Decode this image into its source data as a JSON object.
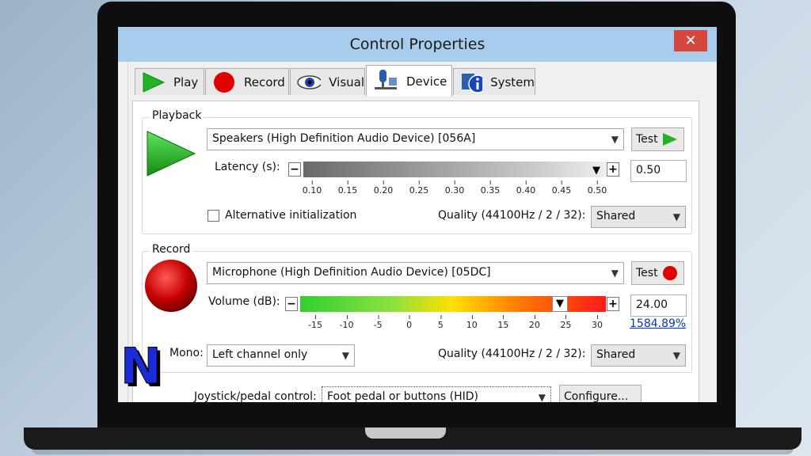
{
  "window": {
    "title": "Control Properties",
    "close_glyph": "✕"
  },
  "tabs": [
    {
      "label": "Play",
      "icon": "play-icon"
    },
    {
      "label": "Record",
      "icon": "record-icon"
    },
    {
      "label": "Visual",
      "icon": "eye-icon"
    },
    {
      "label": "Device",
      "icon": "device-icon",
      "active": true
    },
    {
      "label": "System",
      "icon": "system-info-icon"
    }
  ],
  "playback": {
    "legend": "Playback",
    "device": "Speakers (High Definition Audio Device) [056A]",
    "test_label": "Test",
    "latency_label": "Latency (s):",
    "latency_value": "0.50",
    "latency_ticks": [
      "0.10",
      "0.15",
      "0.20",
      "0.25",
      "0.30",
      "0.35",
      "0.40",
      "0.45",
      "0.50"
    ],
    "alt_init_label": "Alternative initialization",
    "alt_init_checked": false,
    "quality_label": "Quality (44100Hz / 2 / 32):",
    "quality_value": "Shared"
  },
  "record": {
    "legend": "Record",
    "device": "Microphone (High Definition Audio Device) [05DC]",
    "test_label": "Test",
    "volume_label": "Volume (dB):",
    "volume_value": "24.00",
    "volume_percent": "1584.89%",
    "volume_ticks": [
      "-15",
      "-10",
      "-5",
      "0",
      "5",
      "10",
      "15",
      "20",
      "25",
      "30"
    ],
    "mono_label": "Mono:",
    "mono_value": "Left channel only",
    "quality_label": "Quality (44100Hz / 2 / 32):",
    "quality_value": "Shared"
  },
  "joystick": {
    "label": "Joystick/pedal control:",
    "value": "Foot pedal or buttons (HID)",
    "configure_label": "Configure..."
  },
  "colors": {
    "title_bar": "#a8cceb",
    "close": "#d5473c",
    "play_green": "#22b422",
    "record_red": "#cc1111"
  },
  "slider_symbols": {
    "minus": "−",
    "plus": "+",
    "arrow": "▼"
  },
  "overlay_logo": "N"
}
